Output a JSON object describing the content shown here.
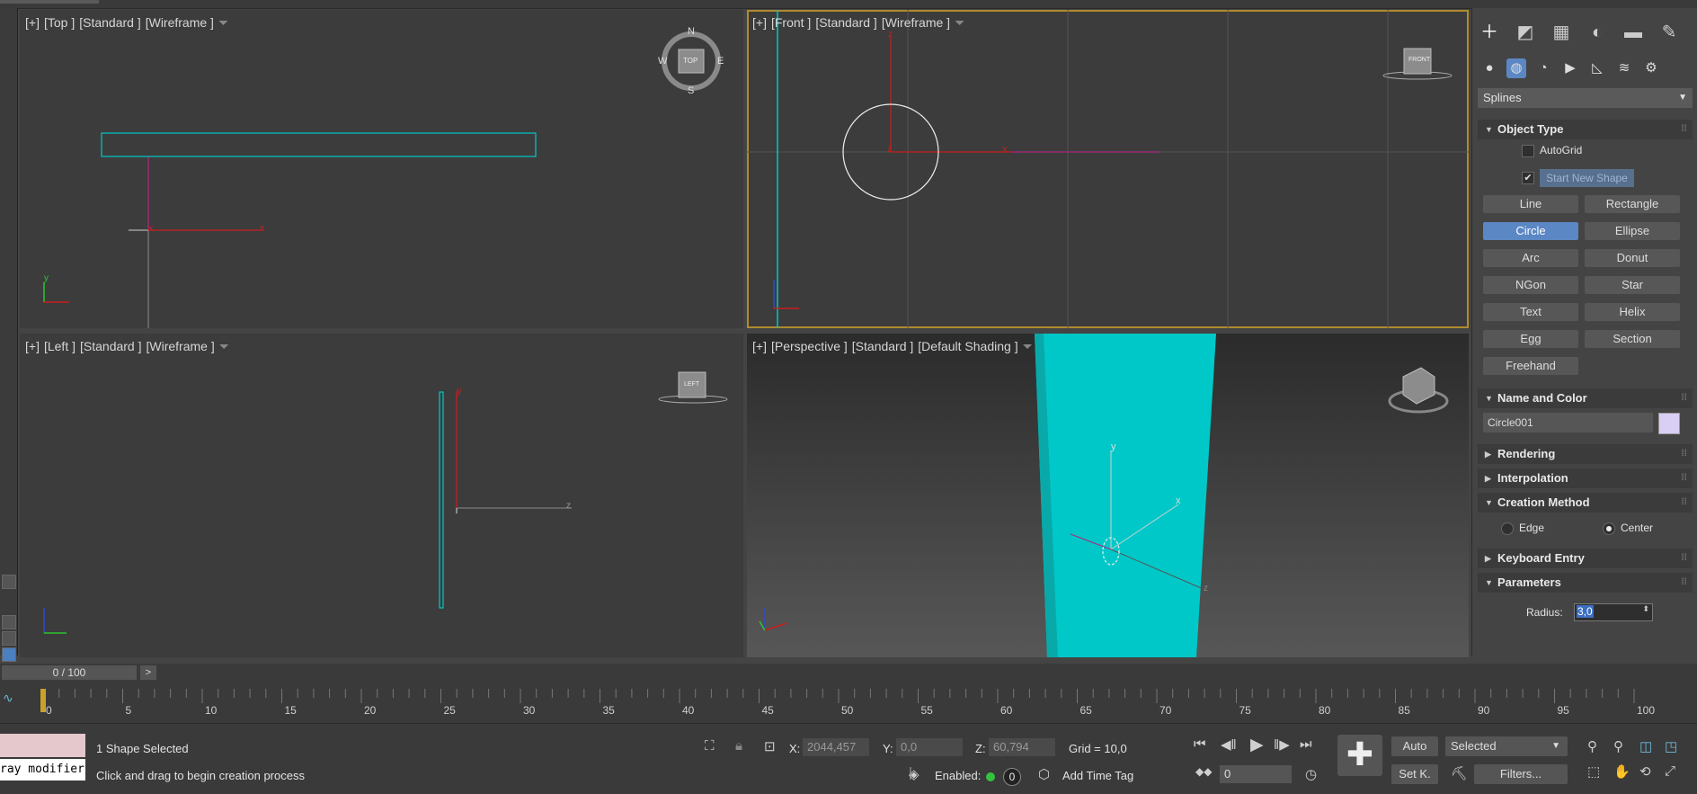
{
  "viewports": {
    "top": {
      "labels": [
        "[+]",
        "[Top ]",
        "[Standard ]",
        "[Wireframe ]"
      ],
      "axes": {
        "x": "x",
        "y": "y"
      }
    },
    "front": {
      "labels": [
        "[+]",
        "[Front ]",
        "[Standard ]",
        "[Wireframe ]"
      ],
      "axes": {
        "x": "x",
        "z": "z"
      }
    },
    "left": {
      "labels": [
        "[+]",
        "[Left ]",
        "[Standard ]",
        "[Wireframe ]"
      ],
      "axes": {
        "y": "y",
        "z": "z"
      }
    },
    "perspective": {
      "labels": [
        "[+]",
        "[Perspective ]",
        "[Standard ]",
        "[Default Shading ]"
      ],
      "axes": {
        "x": "x",
        "y": "y",
        "z": "z"
      }
    },
    "compass": {
      "n": "N",
      "s": "S",
      "e": "E",
      "w": "W",
      "top": "TOP"
    },
    "viewcube_front": "FRONT",
    "viewcube_left": "LEFT"
  },
  "command_panel": {
    "category_dropdown": "Splines",
    "object_type": {
      "title": "Object Type",
      "autogrid": "AutoGrid",
      "start_new_shape": "Start New Shape",
      "start_new_shape_checked": true,
      "buttons": [
        "Line",
        "Rectangle",
        "Circle",
        "Ellipse",
        "Arc",
        "Donut",
        "NGon",
        "Star",
        "Text",
        "Helix",
        "Egg",
        "Section",
        "Freehand"
      ],
      "selected": "Circle"
    },
    "name_and_color": {
      "title": "Name and Color",
      "name": "Circle001",
      "color": "#d9cff5"
    },
    "rendering": "Rendering",
    "interpolation": "Interpolation",
    "creation_method": {
      "title": "Creation Method",
      "edge": "Edge",
      "center": "Center",
      "selected": "Center"
    },
    "keyboard_entry": "Keyboard Entry",
    "parameters": {
      "title": "Parameters",
      "radius_label": "Radius:",
      "radius_value": "3,0"
    }
  },
  "timeline": {
    "slider": "0 / 100",
    "next": ">",
    "ticks": [
      "0",
      "5",
      "10",
      "15",
      "20",
      "25",
      "30",
      "35",
      "40",
      "45",
      "50",
      "55",
      "60",
      "65",
      "70",
      "75",
      "80",
      "85",
      "90",
      "95",
      "100"
    ],
    "current_frame": 0
  },
  "status": {
    "maxscript_text": "ray modifier",
    "selection": "1 Shape Selected",
    "prompt": "Click and drag to begin creation process",
    "x_label": "X:",
    "x_value": "2044,457",
    "y_label": "Y:",
    "y_value": "0,0",
    "z_label": "Z:",
    "z_value": "60,794",
    "grid": "Grid = 10,0",
    "enabled": "Enabled:",
    "enabled_count": "0",
    "add_time_tag": "Add Time Tag",
    "auto": "Auto",
    "set_key": "Set K.",
    "selected_dropdown": "Selected",
    "filters": "Filters...",
    "frame_value": "0"
  },
  "colors": {
    "accent": "#5b87c5",
    "active_border": "#b08a2e",
    "cyan": "#00c8c8",
    "axis_red": "#c81e1e"
  }
}
